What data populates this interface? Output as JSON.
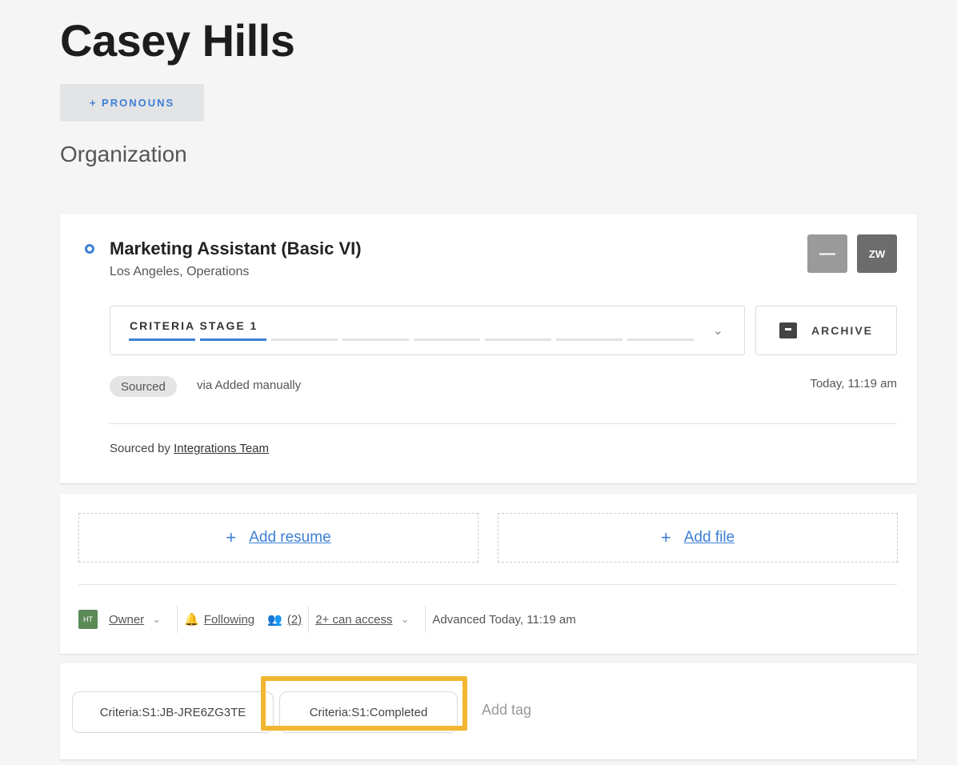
{
  "candidate": {
    "name": "Casey Hills",
    "pronouns_button": "+ PRONOUNS",
    "organization": "Organization"
  },
  "job": {
    "title": "Marketing Assistant (Basic VI)",
    "subtitle": "Los Angeles, Operations",
    "minus_button": "—",
    "avatar_button": "ZW",
    "stage_label": "CRITERIA STAGE 1",
    "stage_progress": {
      "completed": 2,
      "total": 8
    },
    "archive_label": "ARCHIVE",
    "source_badge": "Sourced",
    "source_via": "via Added manually",
    "timestamp": "Today, 11:19 am",
    "sourced_by_prefix": "Sourced by",
    "sourced_by_name": "Integrations Team"
  },
  "files": {
    "add_resume": "Add resume",
    "add_file": "Add file"
  },
  "meta": {
    "owner_avatar": "HT",
    "owner": "Owner",
    "following": "Following",
    "followers_count": "(2)",
    "access": "2+ can access",
    "advanced": "Advanced Today, 11:19 am"
  },
  "tags": {
    "items": [
      "Criteria:S1:JB-JRE6ZG3TE",
      "Criteria:S1:Completed"
    ],
    "add_tag": "Add tag"
  },
  "colors": {
    "accent": "#3d7fd6",
    "highlight": "#f2b731"
  }
}
